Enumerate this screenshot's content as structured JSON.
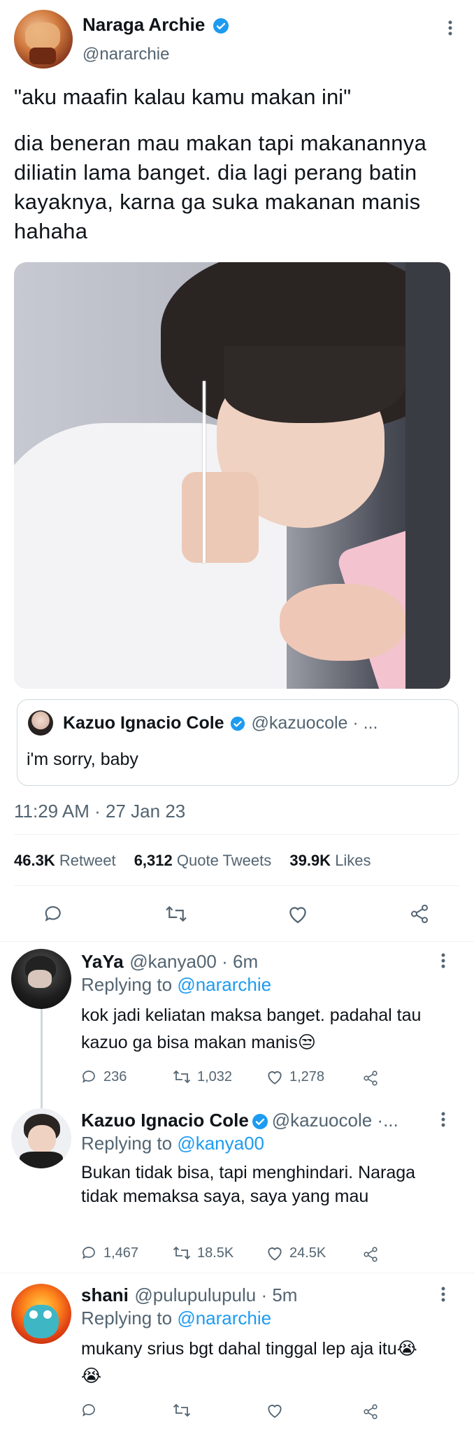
{
  "main_tweet": {
    "author_name": "Naraga Archie",
    "author_handle": "@nararchie",
    "text_line1": "\"aku maafin kalau kamu makan ini\"",
    "text_para2": "dia beneran mau makan tapi makanannya diliatin lama banget. dia lagi perang batin kayaknya, karna ga suka makanan manis hahaha",
    "timestamp": "11:29 AM · 27 Jan 23",
    "stats": {
      "retweets_value": "46.3K",
      "retweets_label": "Retweet",
      "quotes_value": "6,312",
      "quotes_label": "Quote Tweets",
      "likes_value": "39.9K",
      "likes_label": "Likes"
    },
    "quoted": {
      "author_name": "Kazuo Ignacio Cole",
      "author_handle": "@kazuocole · ...",
      "text": "i'm sorry, baby"
    }
  },
  "replies": [
    {
      "name": "YaYa",
      "handle": "@kanya00 · 6m",
      "replying_label": "Replying to",
      "replying_to": "@nararchie",
      "text": "kok jadi keliatan maksa banget. padahal tau kazuo ga bisa makan manis😒",
      "replies": "236",
      "retweets": "1,032",
      "likes": "1,278"
    },
    {
      "name": "Kazuo Ignacio Cole",
      "handle": "@kazuocole ·...",
      "replying_label": "Replying to",
      "replying_to": "@kanya00",
      "text": "Bukan tidak bisa, tapi menghindari. Naraga tidak memaksa saya, saya yang mau",
      "replies": "1,467",
      "retweets": "18.5K",
      "likes": "24.5K"
    },
    {
      "name": "shani",
      "handle": "@pulupulupulu · 5m",
      "replying_label": "Replying to",
      "replying_to": "@nararchie",
      "text": "mukany srius bgt dahal tinggal lep aja itu😭😭",
      "replies": "",
      "retweets": "",
      "likes": ""
    }
  ],
  "colors": {
    "accent": "#1d9bf0",
    "muted": "#536471",
    "text": "#0f1419"
  }
}
